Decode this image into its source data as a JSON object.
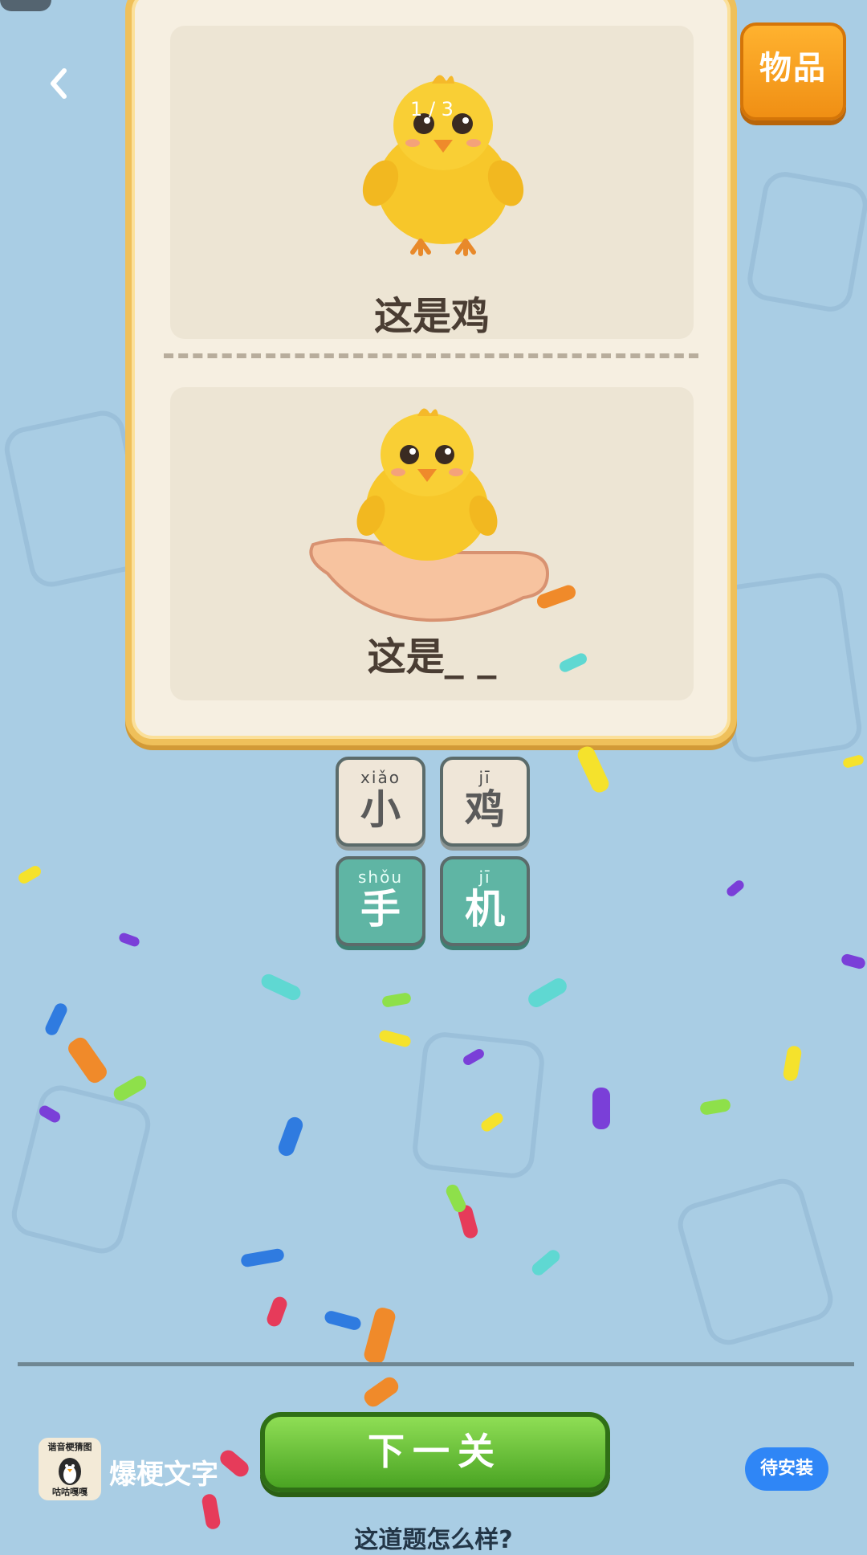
{
  "header": {
    "items_label": "物品",
    "page_indicator": "1 / 3"
  },
  "card": {
    "top_caption": "这是鸡",
    "bottom_caption": "这是_ _"
  },
  "tiles": [
    {
      "pinyin": "xiǎo",
      "char": "小",
      "style": "beige"
    },
    {
      "pinyin": "jī",
      "char": "鸡",
      "style": "beige"
    },
    {
      "pinyin": "shǒu",
      "char": "手",
      "style": "teal"
    },
    {
      "pinyin": "jī",
      "char": "机",
      "style": "teal"
    }
  ],
  "next_button_label": "下一关",
  "ad": {
    "icon_top_text": "谐音梗猜图",
    "icon_bottom_text": "咕咕嘎嘎",
    "app_name": "爆梗文字",
    "install_label": "待安装"
  },
  "feedback_text": "这道题怎么样?",
  "colors": {
    "background": "#a9cde4",
    "card_border": "#efc05a",
    "items_button": "#f59c1e",
    "next_button": "#5cb82e",
    "install_button": "#2f86f6",
    "tile_teal": "#5fb5a4"
  }
}
